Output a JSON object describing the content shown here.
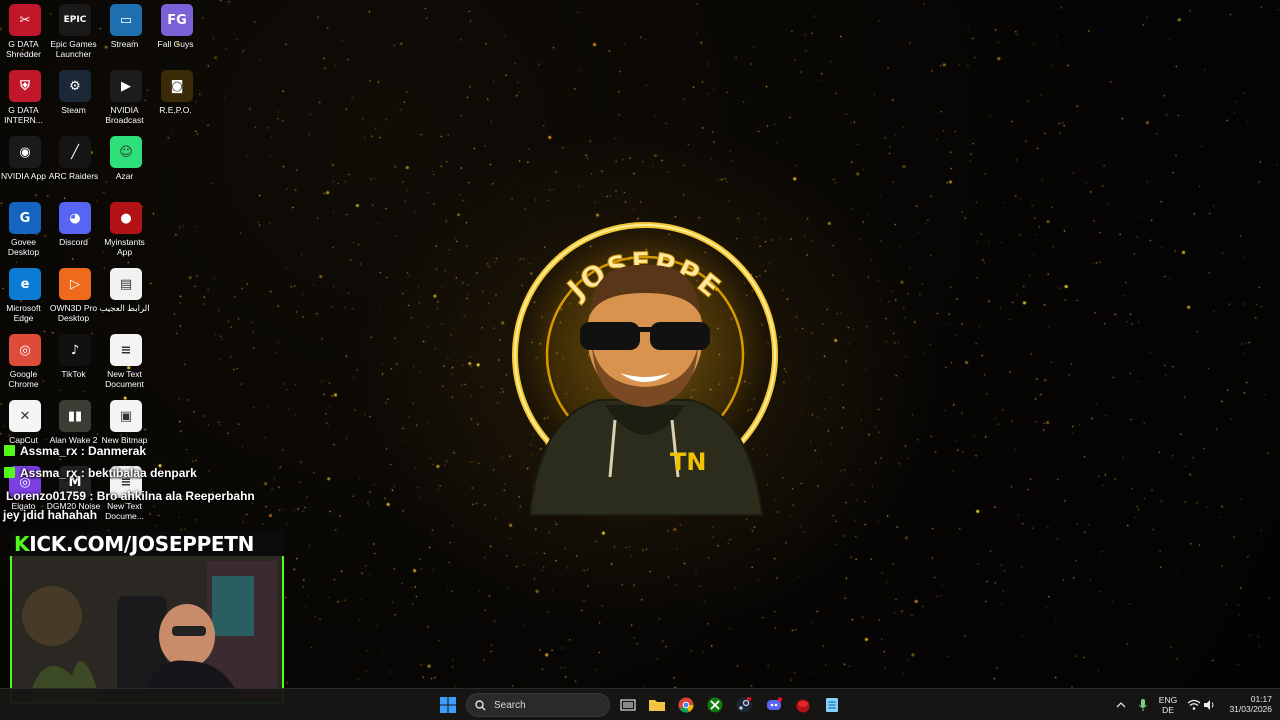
{
  "desktop": {
    "icons": [
      {
        "label": "G DATA Shredder",
        "icon": "gdata-shredder-icon",
        "color": "#c0182a",
        "glyph": "✂"
      },
      {
        "label": "Epic Games Launcher",
        "icon": "epic-games-icon",
        "color": "#1a1a1a",
        "glyph": "EPIC"
      },
      {
        "label": "Stream",
        "icon": "monitor-icon",
        "color": "#1e6fb0",
        "glyph": "▭"
      },
      {
        "label": "Fall Guys",
        "icon": "fall-guys-icon",
        "color": "#7a62d6",
        "glyph": "FG"
      },
      {
        "label": "G DATA INTERN...",
        "icon": "gdata-shield-icon",
        "color": "#c0182a",
        "glyph": "⛨"
      },
      {
        "label": "Steam",
        "icon": "steam-icon",
        "color": "#1b2838",
        "glyph": "⚙"
      },
      {
        "label": "NVIDIA Broadcast",
        "icon": "nvidia-broadcast-icon",
        "color": "#1c1c1c",
        "glyph": "▶"
      },
      {
        "label": "R.E.P.O.",
        "icon": "repo-game-icon",
        "color": "#3a2a08",
        "glyph": "◙"
      },
      {
        "label": "NVIDIA App",
        "icon": "nvidia-app-icon",
        "color": "#1a1a1a",
        "glyph": "◉"
      },
      {
        "label": "ARC Raiders",
        "icon": "arc-raiders-icon",
        "color": "#151515",
        "glyph": "╱"
      },
      {
        "label": "Azar",
        "icon": "azar-icon",
        "color": "#2ee07a",
        "glyph": "☺"
      },
      {
        "label": "Govee Desktop",
        "icon": "govee-icon",
        "color": "#1565c0",
        "glyph": "G"
      },
      {
        "label": "Discord",
        "icon": "discord-icon",
        "color": "#5865f2",
        "glyph": "◕"
      },
      {
        "label": "Myinstants App",
        "icon": "myinstants-icon",
        "color": "#b31217",
        "glyph": "●"
      },
      {
        "label": "Microsoft Edge",
        "icon": "edge-icon",
        "color": "#0c7bd4",
        "glyph": "e"
      },
      {
        "label": "OWN3D Pro Desktop",
        "icon": "own3d-icon",
        "color": "#ef6a1a",
        "glyph": "▷"
      },
      {
        "label": "الرابط العجيب",
        "icon": "document-icon",
        "color": "#f2f2f2",
        "glyph": "▤"
      },
      {
        "label": "Google Chrome",
        "icon": "chrome-icon",
        "color": "#dd4b39",
        "glyph": "◎"
      },
      {
        "label": "TikTok",
        "icon": "tiktok-icon",
        "color": "#111111",
        "glyph": "♪"
      },
      {
        "label": "New Text Document",
        "icon": "text-file-icon",
        "color": "#f4f4f4",
        "glyph": "≡"
      },
      {
        "label": "CapCut",
        "icon": "capcut-icon",
        "color": "#f5f5f5",
        "glyph": "✕"
      },
      {
        "label": "Alan Wake 2",
        "icon": "alan-wake-icon",
        "color": "#3c3c34",
        "glyph": "▮▮"
      },
      {
        "label": "New Bitmap",
        "icon": "bitmap-file-icon",
        "color": "#f4f4f4",
        "glyph": "▣"
      },
      {
        "label": "Elgato",
        "icon": "elgato-icon",
        "color": "#7b3fe4",
        "glyph": "◎"
      },
      {
        "label": "DGM20 Noise",
        "icon": "dgm-icon",
        "color": "#222222",
        "glyph": "M"
      },
      {
        "label": "New Text Docume...",
        "icon": "text-file-icon",
        "color": "#f4f4f4",
        "glyph": "≡"
      }
    ]
  },
  "wallpaper": {
    "logo_text": "JOSEPPE",
    "hoodie_text": "TN"
  },
  "chat": {
    "lines": [
      {
        "text": "Assma_rx : Danmerak"
      },
      {
        "text": "Assma_rx : bektibalaa denpark"
      },
      {
        "text": "Lorenzo01759 : Bro ahkilna ala Reeperbahn"
      },
      {
        "text": "jey jdid hahahah"
      }
    ],
    "banner_k": "K",
    "banner_rest": "ICK.COM/JOSEPPETN"
  },
  "taskbar": {
    "search_placeholder": "Search",
    "apps": [
      "start-icon",
      "task-view-icon",
      "file-explorer-icon",
      "chrome-icon",
      "xbox-icon",
      "steam-icon",
      "discord-icon",
      "myinstants-icon",
      "notepad-icon"
    ],
    "lang_top": "ENG",
    "lang_bottom": "DE",
    "time": "01:17",
    "date": "31/03/2026"
  },
  "colors": {
    "accent_green": "#53fc18",
    "glow_gold": "#f5b800"
  }
}
